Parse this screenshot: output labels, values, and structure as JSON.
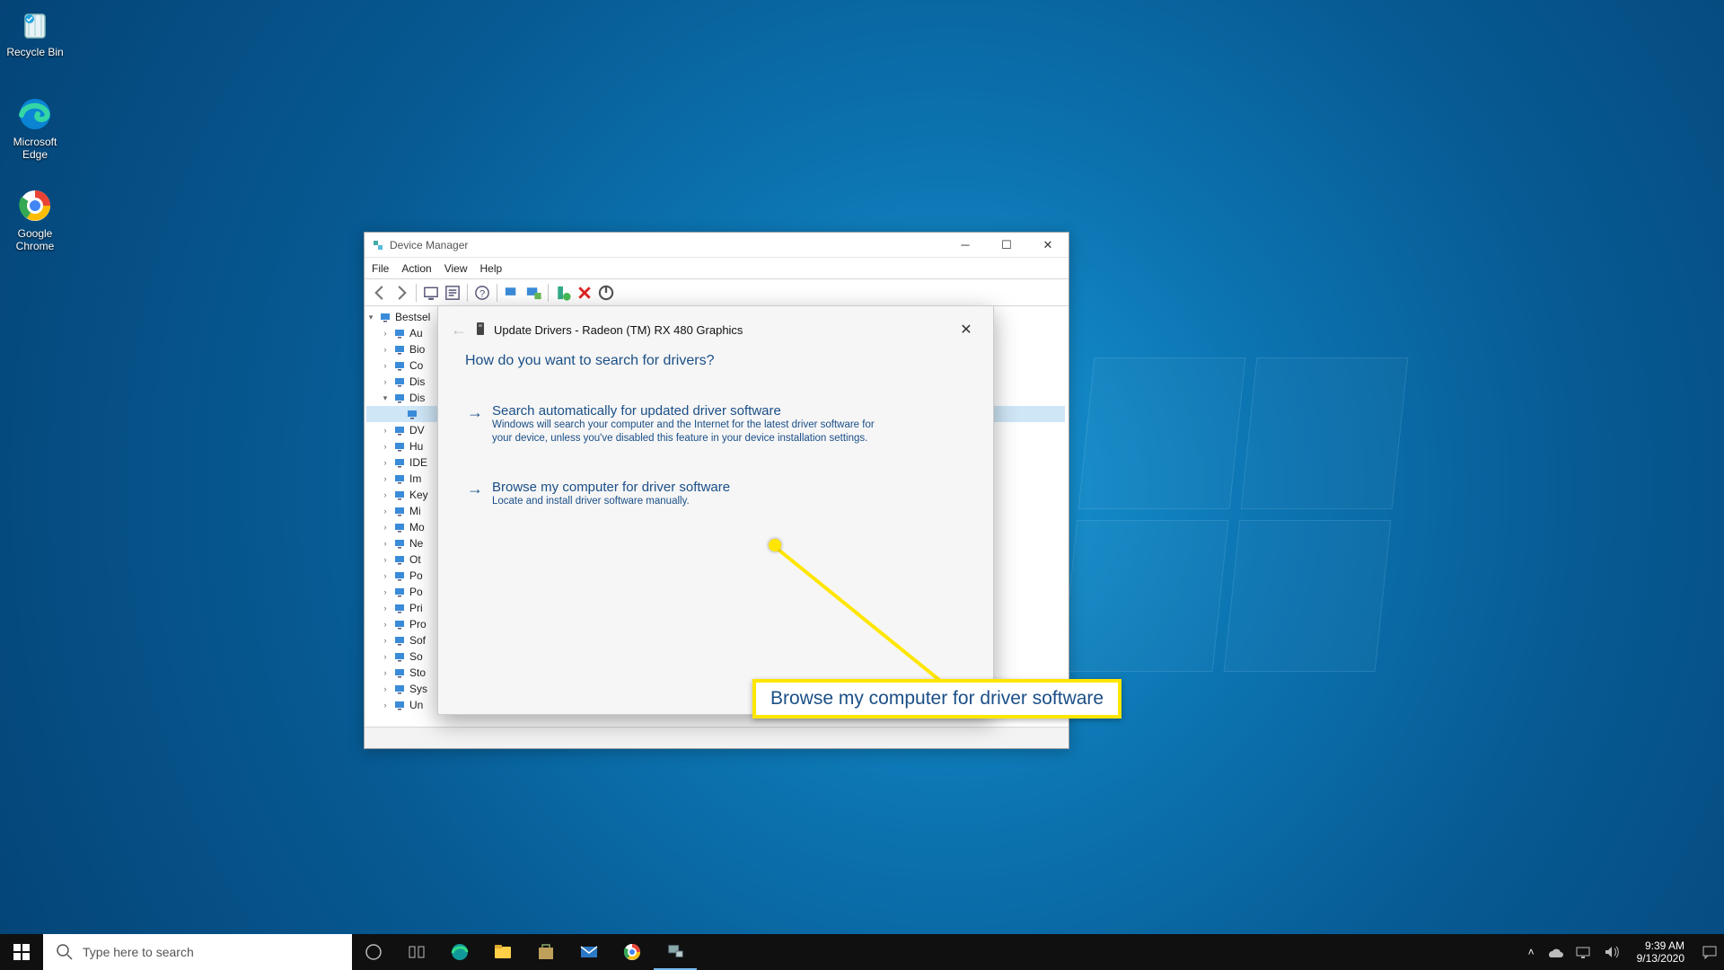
{
  "desktop_icons": {
    "recycle": "Recycle Bin",
    "edge": "Microsoft Edge",
    "chrome": "Google Chrome"
  },
  "device_manager": {
    "title": "Device Manager",
    "menu": [
      "File",
      "Action",
      "View",
      "Help"
    ],
    "root": "Bestsel",
    "tree": [
      "Au",
      "Bio",
      "Co",
      "Dis",
      "Dis",
      "DV",
      "Hu",
      "IDE",
      "Im",
      "Key",
      "Mi",
      "Mo",
      "Ne",
      "Ot",
      "Po",
      "Po",
      "Pri",
      "Pro",
      "Sof",
      "So",
      "Sto",
      "Sys",
      "Un"
    ]
  },
  "update_drivers": {
    "title": "Update Drivers - Radeon (TM) RX 480 Graphics",
    "question": "How do you want to search for drivers?",
    "opt1_title": "Search automatically for updated driver software",
    "opt1_desc": "Windows will search your computer and the Internet for the latest driver software for your device, unless you've disabled this feature in your device installation settings.",
    "opt2_title": "Browse my computer for driver software",
    "opt2_desc": "Locate and install driver software manually."
  },
  "callout": {
    "text": "Browse my computer for driver software"
  },
  "taskbar": {
    "search_placeholder": "Type here to search",
    "time": "9:39 AM",
    "date": "9/13/2020"
  }
}
